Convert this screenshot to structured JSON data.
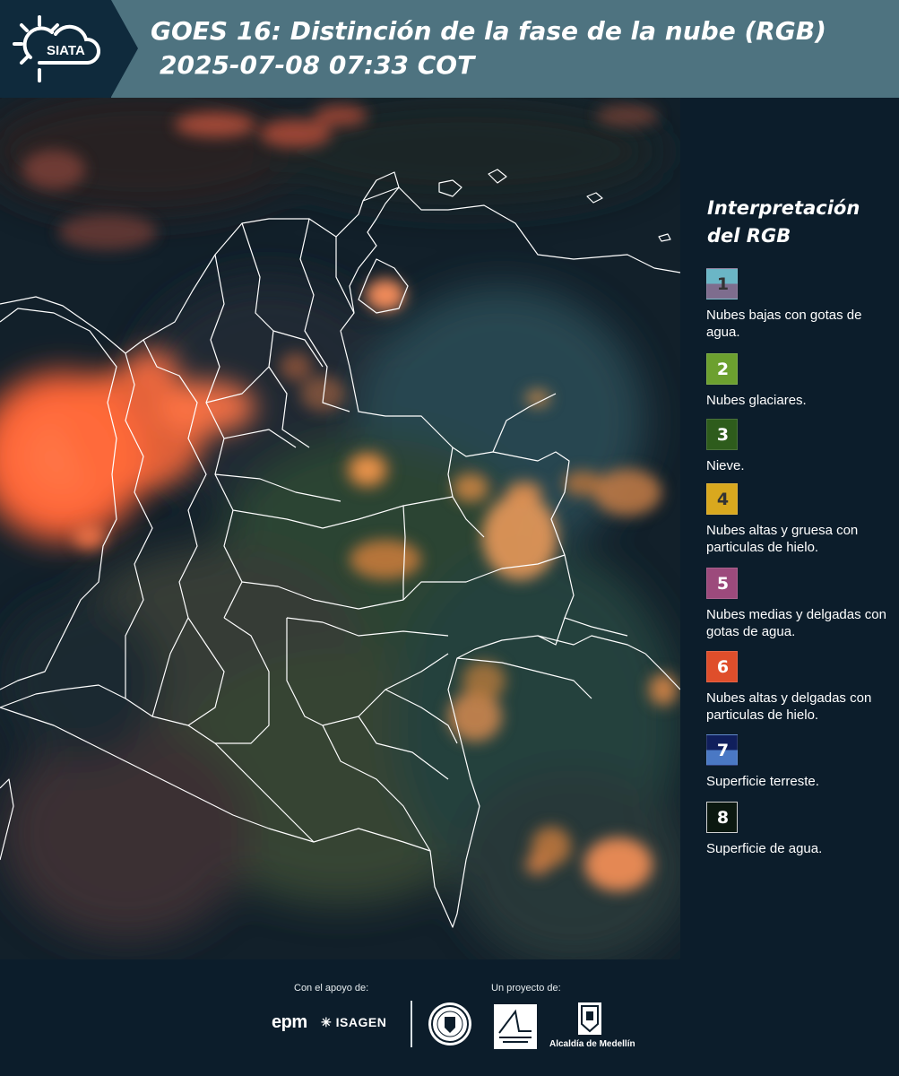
{
  "header": {
    "logo_text": "SIATA",
    "title_line1": "GOES 16: Distinción de la fase de la nube (RGB)",
    "title_line2": "2025-07-08 07:33 COT"
  },
  "legend": {
    "title_line1": "Interpretación",
    "title_line2": "del RGB",
    "items": [
      {
        "num": "1",
        "label": "Nubes bajas con gotas de agua.",
        "color_top": "#6bb6c6",
        "color_bottom": "#7e6d8e",
        "num_color": "#333333"
      },
      {
        "num": "2",
        "label": "Nubes glaciares.",
        "color": "#6ca02f",
        "num_color": "#ffffff"
      },
      {
        "num": "3",
        "label": "Nieve.",
        "color": "#2e5c1c",
        "num_color": "#ffffff"
      },
      {
        "num": "4",
        "label": "Nubes altas y gruesa con particulas de hielo.",
        "color": "#d9a81e",
        "num_color": "#333333"
      },
      {
        "num": "5",
        "label": "Nubes medias y delgadas con gotas de agua.",
        "color": "#9c4a7c",
        "num_color": "#ffffff"
      },
      {
        "num": "6",
        "label": "Nubes altas y delgadas con particulas de hielo.",
        "color": "#df4e2b",
        "num_color": "#ffffff"
      },
      {
        "num": "7",
        "label": "Superficie terreste.",
        "color_top": "#101f5c",
        "color_bottom": "#4a78c4",
        "num_color": "#ffffff"
      },
      {
        "num": "8",
        "label": "Superficie de agua.",
        "color": "#0b1810",
        "num_color": "#ffffff"
      }
    ]
  },
  "footer": {
    "support_label": "Con el apoyo de:",
    "project_label": "Un proyecto de:",
    "sponsor1": "epm",
    "sponsor2": "ISAGEN",
    "alcaldia": "Alcaldía de Medellín"
  }
}
